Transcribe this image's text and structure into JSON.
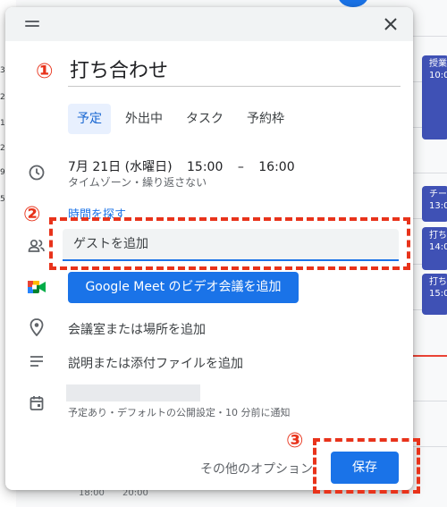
{
  "background": {
    "left_numbers": [
      "3",
      "2",
      "17",
      "2",
      "9",
      "5"
    ],
    "events": [
      {
        "line1": "授業",
        "line2": "10:0"
      },
      {
        "line1": "チー",
        "line2": "13:0"
      },
      {
        "line1": "打ち",
        "line2": "14:0"
      },
      {
        "line1": "打ち",
        "line2": "15:0"
      }
    ],
    "bottom_times": [
      "18:00",
      "20:00"
    ]
  },
  "dialog": {
    "title": "打ち合わせ",
    "tabs": [
      "予定",
      "外出中",
      "タスク",
      "予約枠"
    ],
    "active_tab": "予定",
    "date": "7月 21日 (水曜日)",
    "start_time": "15:00",
    "dash": "–",
    "end_time": "16:00",
    "timezone_repeat": "タイムゾーン・繰り返さない",
    "find_time": "時間を探す",
    "guest_placeholder": "ゲストを追加",
    "meet_button": "Google Meet のビデオ会議を追加",
    "location": "会議室または場所を追加",
    "description": "説明または添付ファイルを追加",
    "calendar_note": "予定あり・デフォルトの公開設定・10 分前に通知",
    "more_options": "その他のオプション",
    "save": "保存"
  },
  "annotations": {
    "marker1": "①",
    "marker2": "②",
    "marker3": "③"
  },
  "colors": {
    "accent": "#1a73e8",
    "annotation": "#e8331b",
    "event": "#3f51b5"
  }
}
